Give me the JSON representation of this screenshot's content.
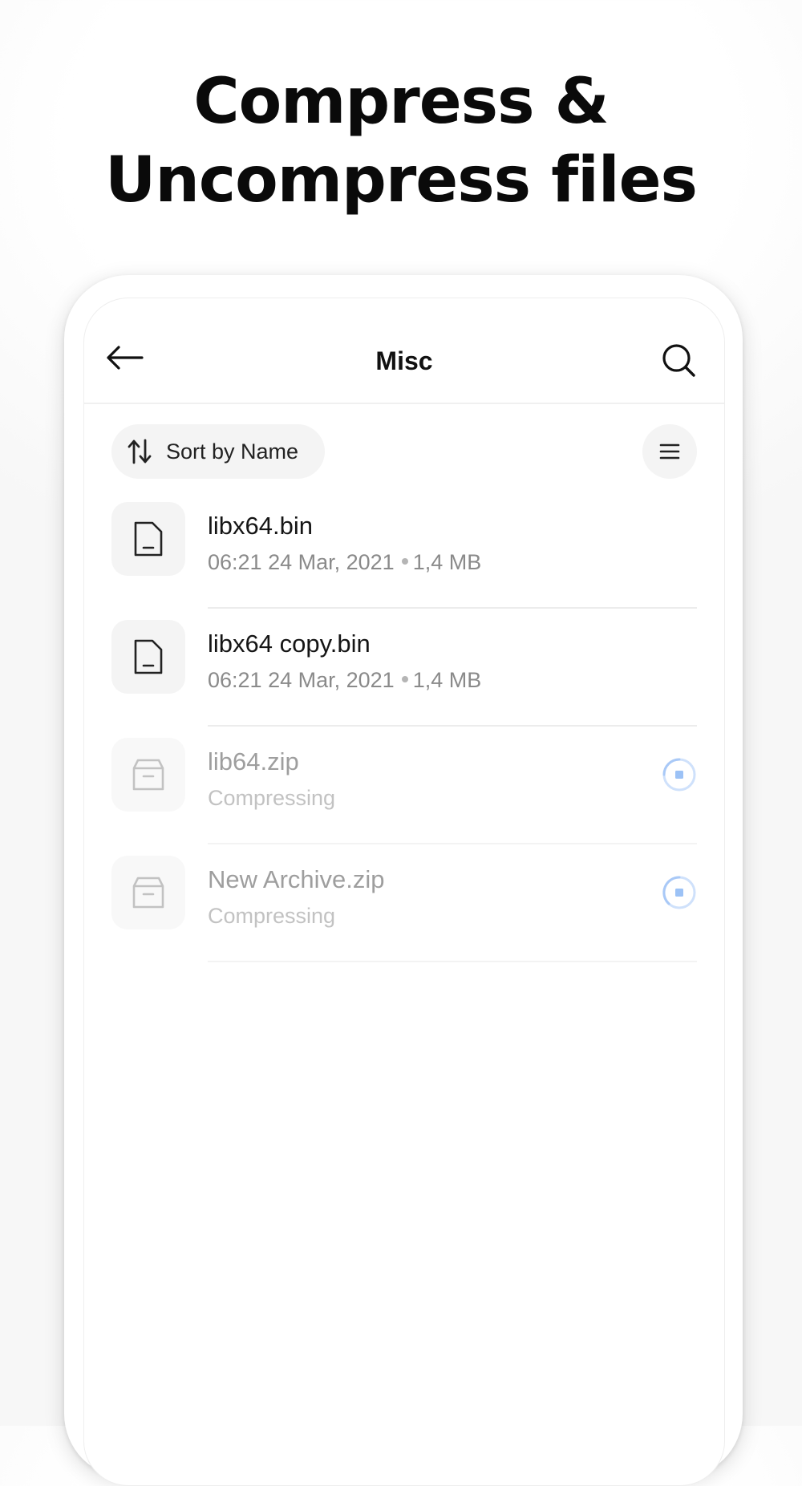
{
  "headline": {
    "line1": "Compress &",
    "line2": "Uncompress files"
  },
  "appbar": {
    "title": "Misc",
    "back_icon": "arrow-left-icon",
    "search_icon": "search-icon"
  },
  "toolbar": {
    "sort_label": "Sort by Name",
    "sort_icon": "sort-arrows-icon",
    "view_icon": "list-view-icon"
  },
  "files": [
    {
      "name": "libx64.bin",
      "date": "06:21 24 Mar, 2021",
      "size": "1,4 MB",
      "icon": "file-icon"
    },
    {
      "name": "libx64 copy.bin",
      "date": "06:21 24 Mar, 2021",
      "size": "1,4 MB",
      "icon": "file-icon"
    },
    {
      "name": "lib64.zip",
      "status": "Compressing",
      "icon": "archive-icon"
    },
    {
      "name": "New Archive.zip",
      "status": "Compressing",
      "icon": "archive-icon"
    }
  ],
  "colors": {
    "accent": "#5b9df5",
    "accent_light": "#cfe1fb",
    "text_primary": "#151515",
    "text_secondary": "#8a8a8a"
  }
}
